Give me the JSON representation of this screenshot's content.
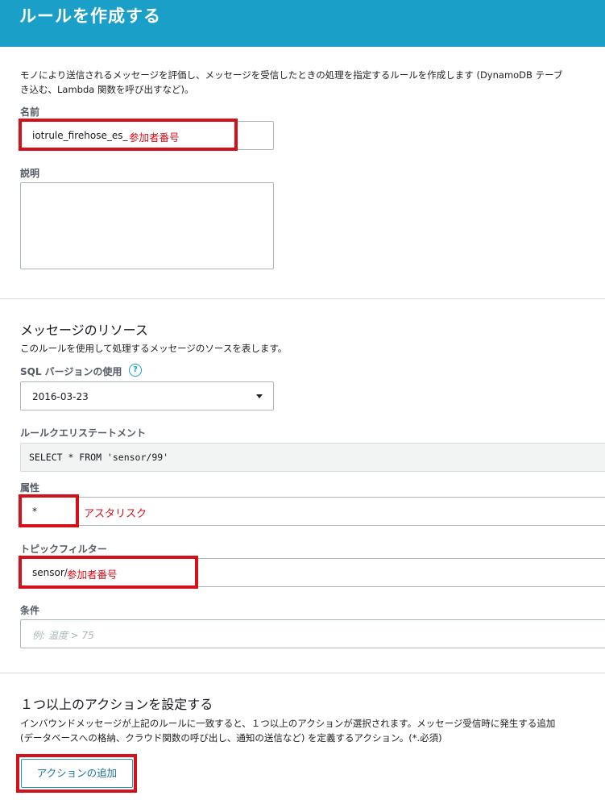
{
  "header": {
    "title": "ルールを作成する"
  },
  "intro": {
    "line1": "モノにより送信されるメッセージを評価し、メッセージを受信したときの処理を指定するルールを作成します (DynamoDB テーブ",
    "line2": "き込む、Lambda 関数を呼び出すなど)。"
  },
  "name_field": {
    "label": "名前",
    "value": "iotrule_firehose_es_",
    "annotation": "参加者番号"
  },
  "description_field": {
    "label": "説明",
    "value": ""
  },
  "message_source": {
    "title": "メッセージのリソース",
    "description": "このルールを使用して処理するメッセージのソースを表します。",
    "sql_version": {
      "label": "SQL バージョンの使用",
      "help": "?",
      "selected": "2016-03-23"
    },
    "query_statement": {
      "label": "ルールクエリステートメント",
      "value": "SELECT * FROM 'sensor/99'"
    },
    "attribute": {
      "label": "属性",
      "value": "*",
      "annotation": "アスタリスク"
    },
    "topic_filter": {
      "label": "トピックフィルター",
      "value": "sensor/",
      "annotation": "参加者番号"
    },
    "condition": {
      "label": "条件",
      "placeholder": "例: 温度 > 75"
    }
  },
  "actions": {
    "title": "１つ以上のアクションを設定する",
    "line1": "インバウンドメッセージが上記のルールに一致すると、１つ以上のアクションが選択されます。メッセージ受信時に発生する追加",
    "line2": "(データベースへの格納、クラウド関数の呼び出し、通知の送信など) を定義するアクション。(*.必須)",
    "add_button": "アクションの追加"
  },
  "colors": {
    "header": "#1aa0c8",
    "highlight": "#d4101a",
    "annotation": "#d4101a"
  }
}
